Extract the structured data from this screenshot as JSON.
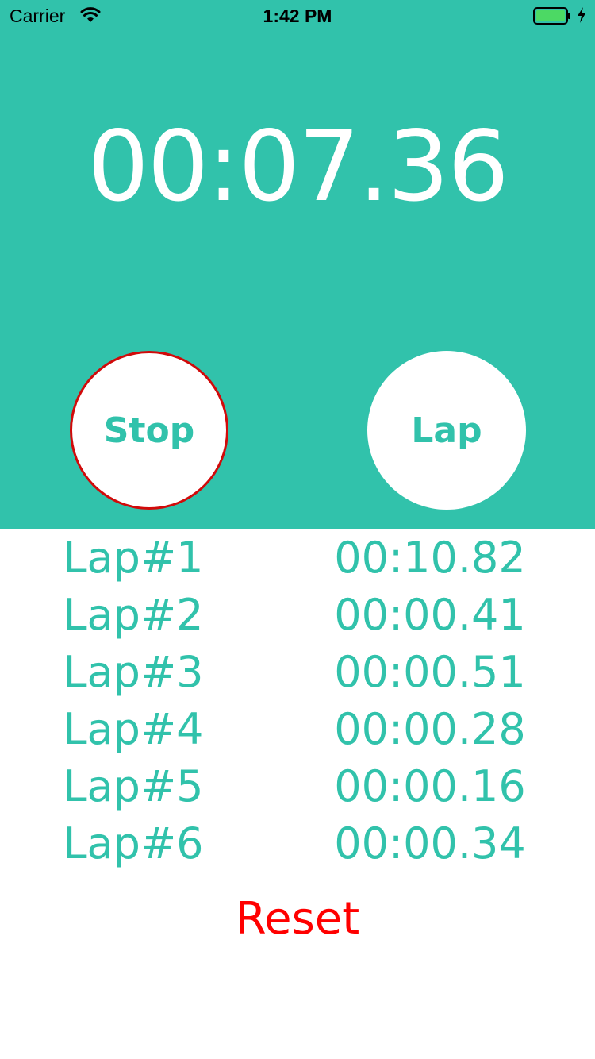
{
  "status_bar": {
    "carrier": "Carrier",
    "time": "1:42 PM",
    "icons": [
      "wifi-icon",
      "battery-icon",
      "charging-bolt-icon"
    ],
    "battery_color": "#4cd964"
  },
  "timer": {
    "display": "00:07.36"
  },
  "buttons": {
    "stop_label": "Stop",
    "lap_label": "Lap",
    "reset_label": "Reset"
  },
  "laps": [
    {
      "name": "Lap#1",
      "time": "00:10.82"
    },
    {
      "name": "Lap#2",
      "time": "00:00.41"
    },
    {
      "name": "Lap#3",
      "time": "00:00.51"
    },
    {
      "name": "Lap#4",
      "time": "00:00.28"
    },
    {
      "name": "Lap#5",
      "time": "00:00.16"
    },
    {
      "name": "Lap#6",
      "time": "00:00.34"
    }
  ],
  "colors": {
    "accent": "#31c2ab",
    "stop_border": "#d10a0a",
    "reset": "#ff0000",
    "background": "#ffffff"
  }
}
